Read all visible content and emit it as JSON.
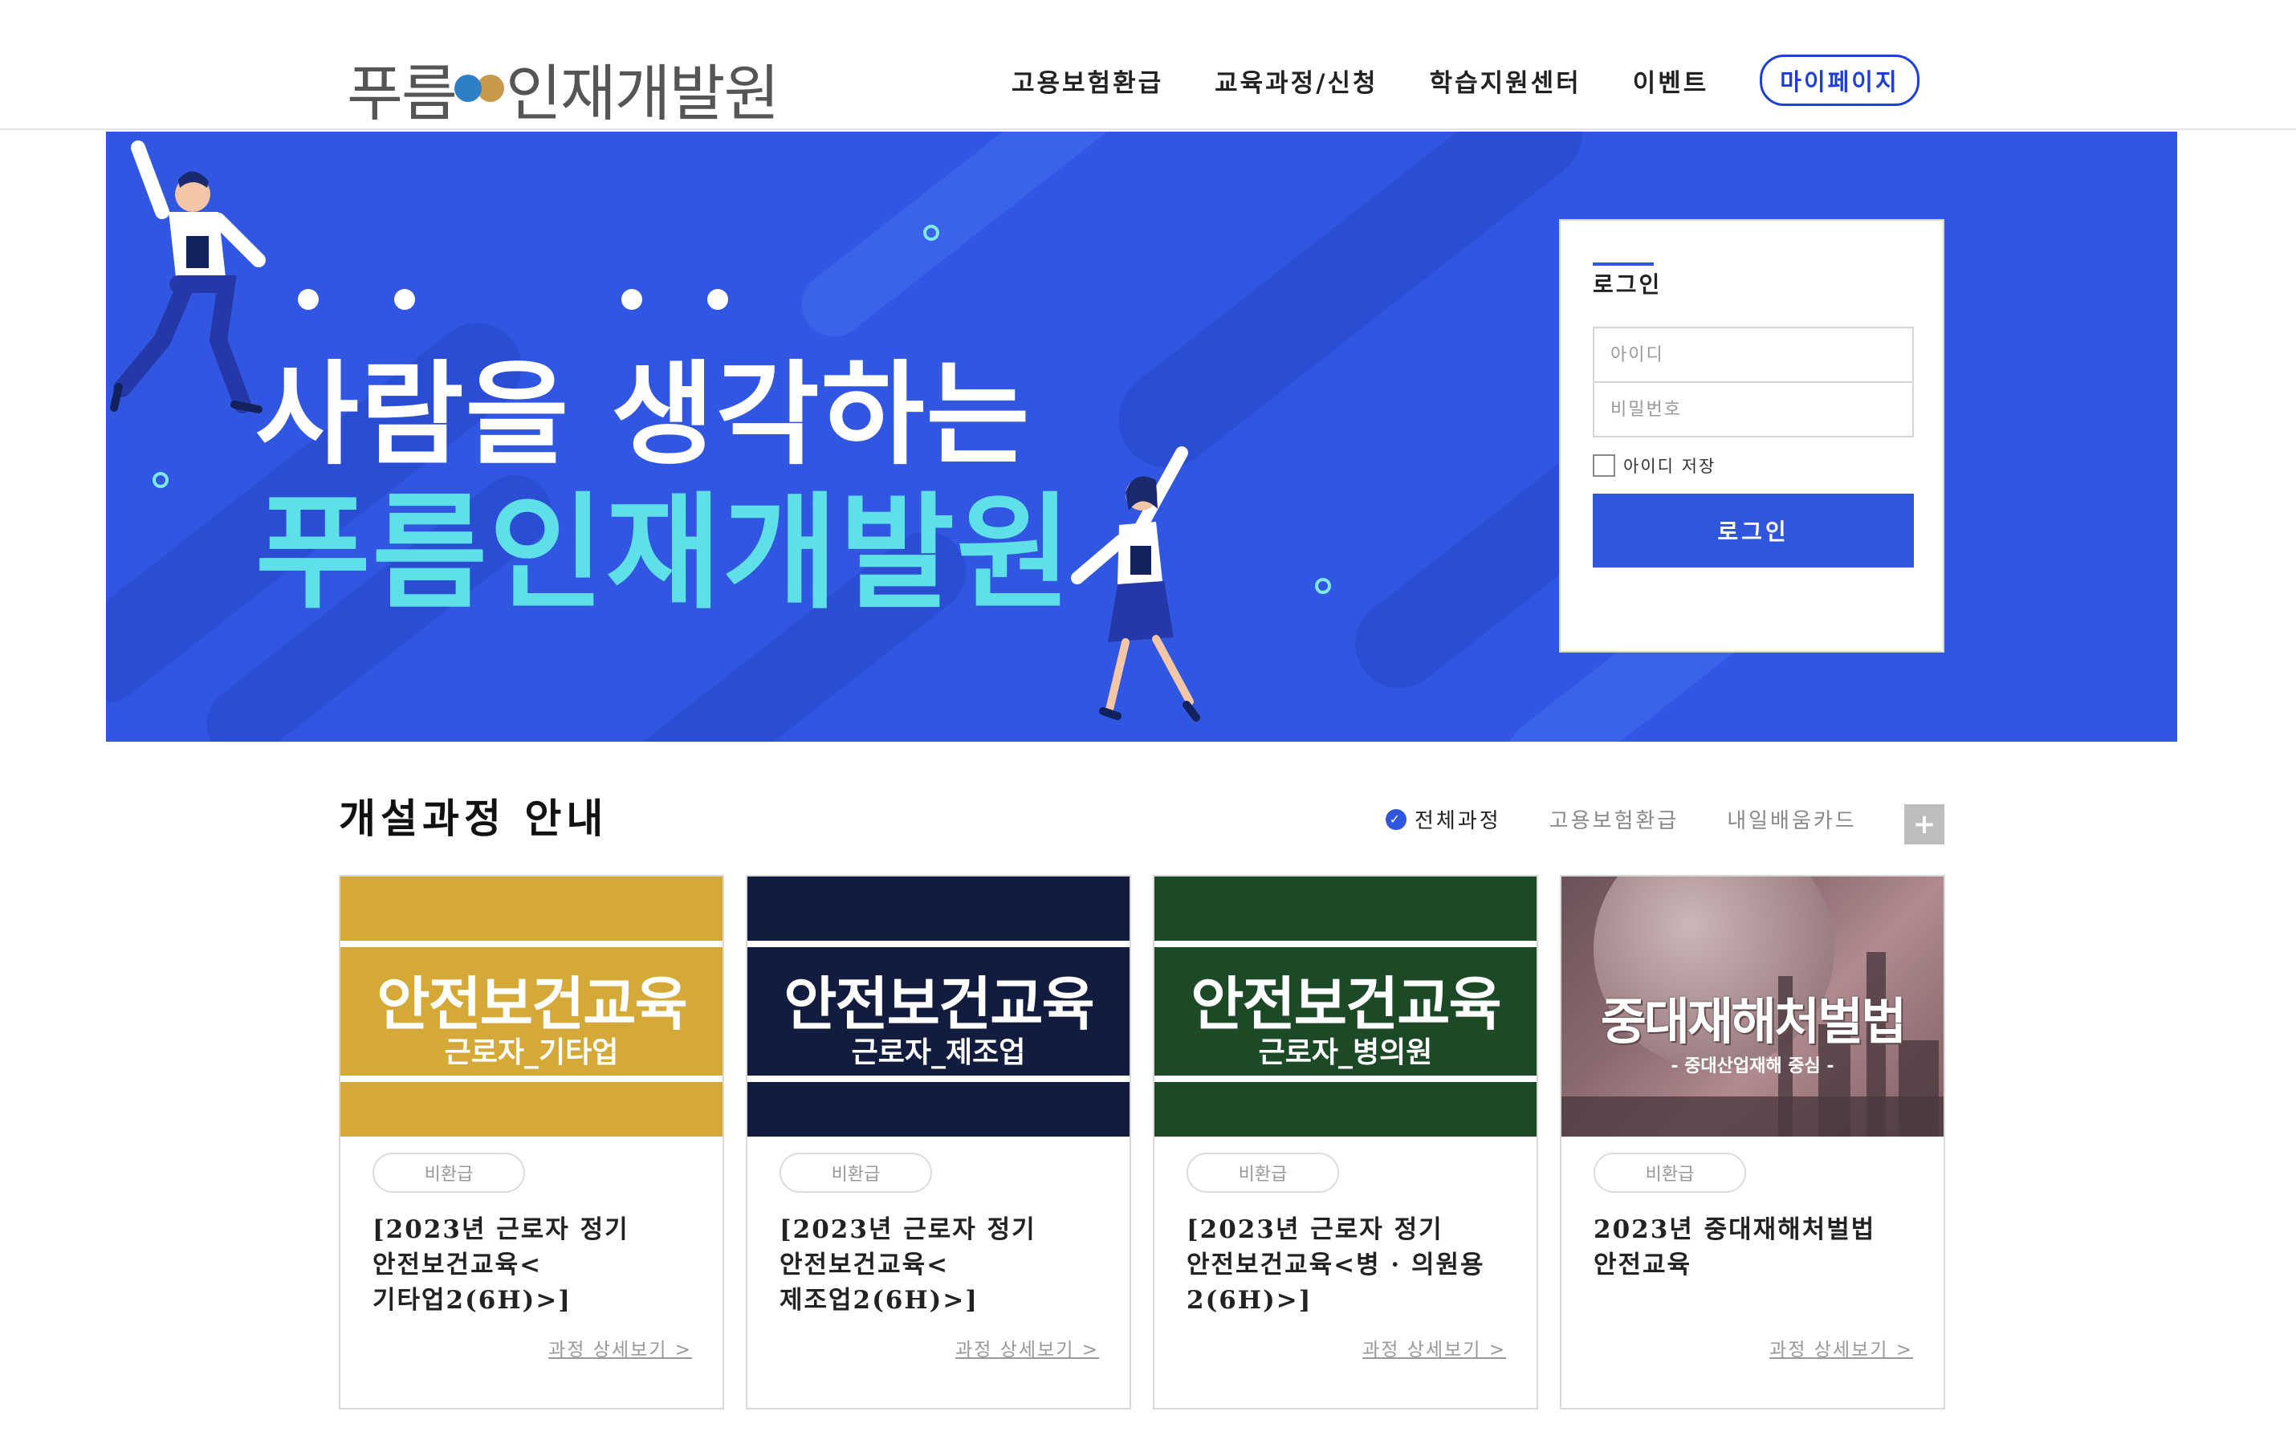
{
  "header": {
    "logo_part1": "푸름",
    "logo_part2": "인재개발원",
    "nav": [
      "고용보험환급",
      "교육과정/신청",
      "학습지원센터",
      "이벤트"
    ],
    "mypage_label": "마이페이지"
  },
  "banner": {
    "headline1": "사람을 생각하는",
    "headline2": "푸름인재개발원"
  },
  "login": {
    "title": "로그인",
    "id_placeholder": "아이디",
    "pw_placeholder": "비밀번호",
    "save_id_label": "아이디 저장",
    "submit_label": "로그인"
  },
  "courses": {
    "section_title": "개설과정 안내",
    "filters": [
      "전체과정",
      "고용보험환급",
      "내일배움카드"
    ],
    "active_filter": "전체과정",
    "more_label": "+",
    "detail_link_label": "과정 상세보기 >",
    "cards": [
      {
        "thumb_main": "안전보건교육",
        "thumb_sub": "근로자_기타업",
        "thumb_color": "#d4a937",
        "badge": "비환급",
        "title": "[2023년 근로자 정기 안전보건교육<기타업2(6H)>]"
      },
      {
        "thumb_main": "안전보건교육",
        "thumb_sub": "근로자_제조업",
        "thumb_color": "#121c3e",
        "badge": "비환급",
        "title": "[2023년 근로자 정기 안전보건교육<제조업2(6H)>]"
      },
      {
        "thumb_main": "안전보건교육",
        "thumb_sub": "근로자_병의원",
        "thumb_color": "#1d4a26",
        "badge": "비환급",
        "title": "[2023년 근로자 정기 안전보건교육<병 · 의원용 2(6H)>]"
      },
      {
        "thumb_main": "중대재해처벌법",
        "thumb_sub": "- 중대산업재해 중심 -",
        "thumb_color": "#7d5e64",
        "badge": "비환급",
        "title": "2023년 중대재해처벌법 안전교육"
      }
    ]
  },
  "colors": {
    "brand_blue": "#2f56dc",
    "banner_bg": "#3157e2",
    "banner_accent": "#5fe0e8"
  }
}
